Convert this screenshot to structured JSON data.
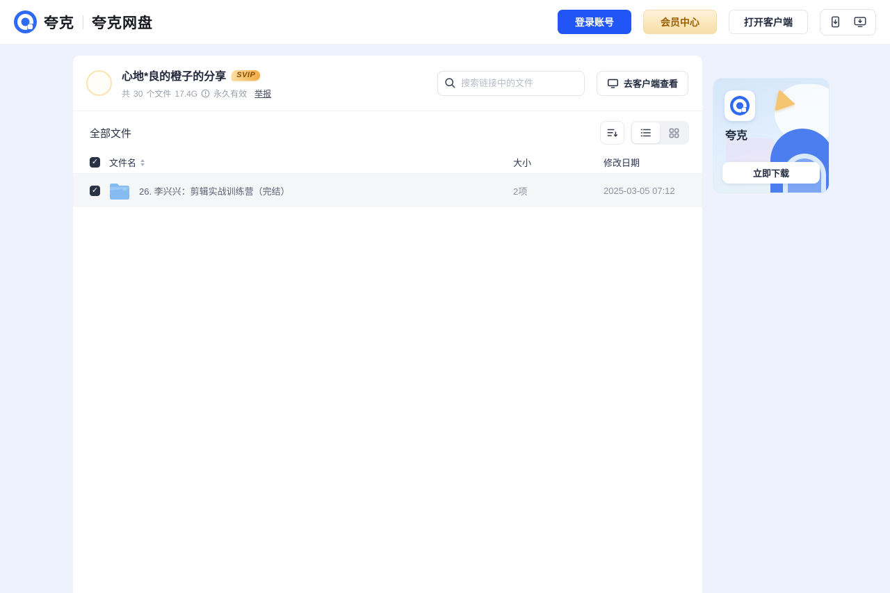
{
  "brand": {
    "app_name": "夸克",
    "product_name": "夸克网盘"
  },
  "header": {
    "login_label": "登录账号",
    "vip_label": "会员中心",
    "open_client_label": "打开客户端"
  },
  "share": {
    "title": "心地*良的橙子的分享",
    "badge": "SVIP",
    "count_prefix": "共",
    "file_count": "30",
    "count_suffix": "个文件",
    "total_size": "17.4G",
    "validity": "永久有效",
    "report_label": "举报"
  },
  "toolbar": {
    "search_placeholder": "搜索链接中的文件",
    "view_in_client_label": "去客户端查看"
  },
  "files": {
    "section_title": "全部文件",
    "columns": {
      "name": "文件名",
      "size": "大小",
      "modified": "修改日期"
    },
    "rows": [
      {
        "name": "26. 李兴兴：剪辑实战训练营（完结）",
        "size": "2项",
        "modified": "2025-03-05 07:12",
        "checked": true
      }
    ]
  },
  "promo": {
    "app_name": "夸克",
    "download_label": "立即下载"
  },
  "icons": {
    "check": "✓"
  },
  "colors": {
    "accent_blue": "#2155f5",
    "brand_blue": "#2e6bf2",
    "vip_gold_text": "#9c5d00",
    "svip_badge": "#f2a93f",
    "folder_blue": "#84bbf1",
    "page_bg": "#edf2fc",
    "row_selected_bg": "#f5f6f8"
  }
}
